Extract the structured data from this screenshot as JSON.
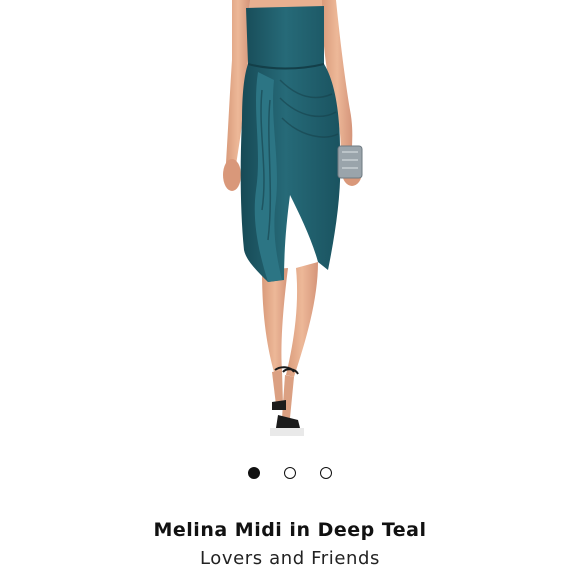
{
  "product": {
    "title": "Melina Midi in Deep Teal",
    "brand": "Lovers and Friends"
  },
  "gallery": {
    "image_count": 3,
    "active_index": 0
  },
  "colors": {
    "dress": "#1f5a67",
    "skin": "#e3a98a",
    "dot": "#111111",
    "background": "#ffffff"
  }
}
